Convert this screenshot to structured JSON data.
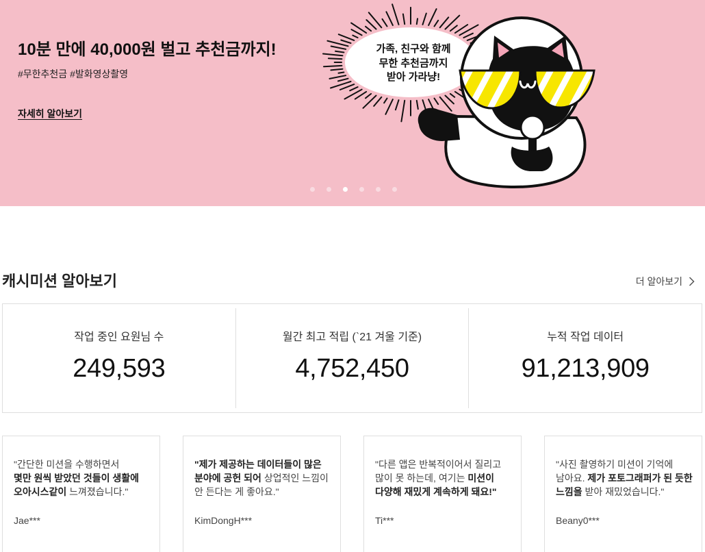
{
  "hero": {
    "background_color": "#f5bec8",
    "title": "10분 만에 40,000원 벌고 추천금까지!",
    "hashtags": "#무한추천금 #발화영상촬영",
    "cta_label": "자세히 알아보기",
    "bubble_lines": [
      "가족, 친구와 함께",
      "무한 추천금까지",
      "받아 가라냥!"
    ],
    "mascot": "cat-with-helmet-and-microphone",
    "carousel": {
      "slide_count": 6,
      "active_index": 2
    }
  },
  "mission_section": {
    "title": "캐시미션 알아보기",
    "more_label": "더 알아보기",
    "more_icon": "chevron-right-icon",
    "stats": [
      {
        "label": "작업 중인 요원님 수",
        "value": "249,593"
      },
      {
        "label": "월간 최고 적립 (`21 겨울 기준)",
        "value": "4,752,450"
      },
      {
        "label": "누적 작업 데이터",
        "value": "91,213,909"
      }
    ]
  },
  "reviews": [
    {
      "lines": [
        [
          "\"간단한 미션을 수행하면서"
        ],
        [
          "몇만 원씩 받았던 것들이 생활에"
        ],
        [
          "오아시스같이",
          " 느껴졌습니다.\""
        ]
      ],
      "author": "Jae***"
    },
    {
      "lines": [
        [
          "\"제가 제공하는 데이터들이 많은"
        ],
        [
          "분야에 공헌 되어",
          " 상업적인 느낌이"
        ],
        [
          "안 든다는 게 좋아요.\""
        ]
      ],
      "author": "KimDongH***"
    },
    {
      "lines": [
        [
          "\"다른 앱은 반복적이어서 질리고"
        ],
        [
          "많이 못 하는데, 여기는 ",
          "미션이"
        ],
        [
          "다양해 재밌게 계속하게 돼요!\""
        ]
      ],
      "author": "Ti***"
    },
    {
      "lines": [
        [
          "\"사진 촬영하기 미션이 기억에"
        ],
        [
          "남아요. ",
          "제가 포토그래퍼가 된 듯한"
        ],
        [
          "느낌을",
          " 받아 재밌었습니다.\""
        ]
      ],
      "author": "Beany0***"
    }
  ]
}
